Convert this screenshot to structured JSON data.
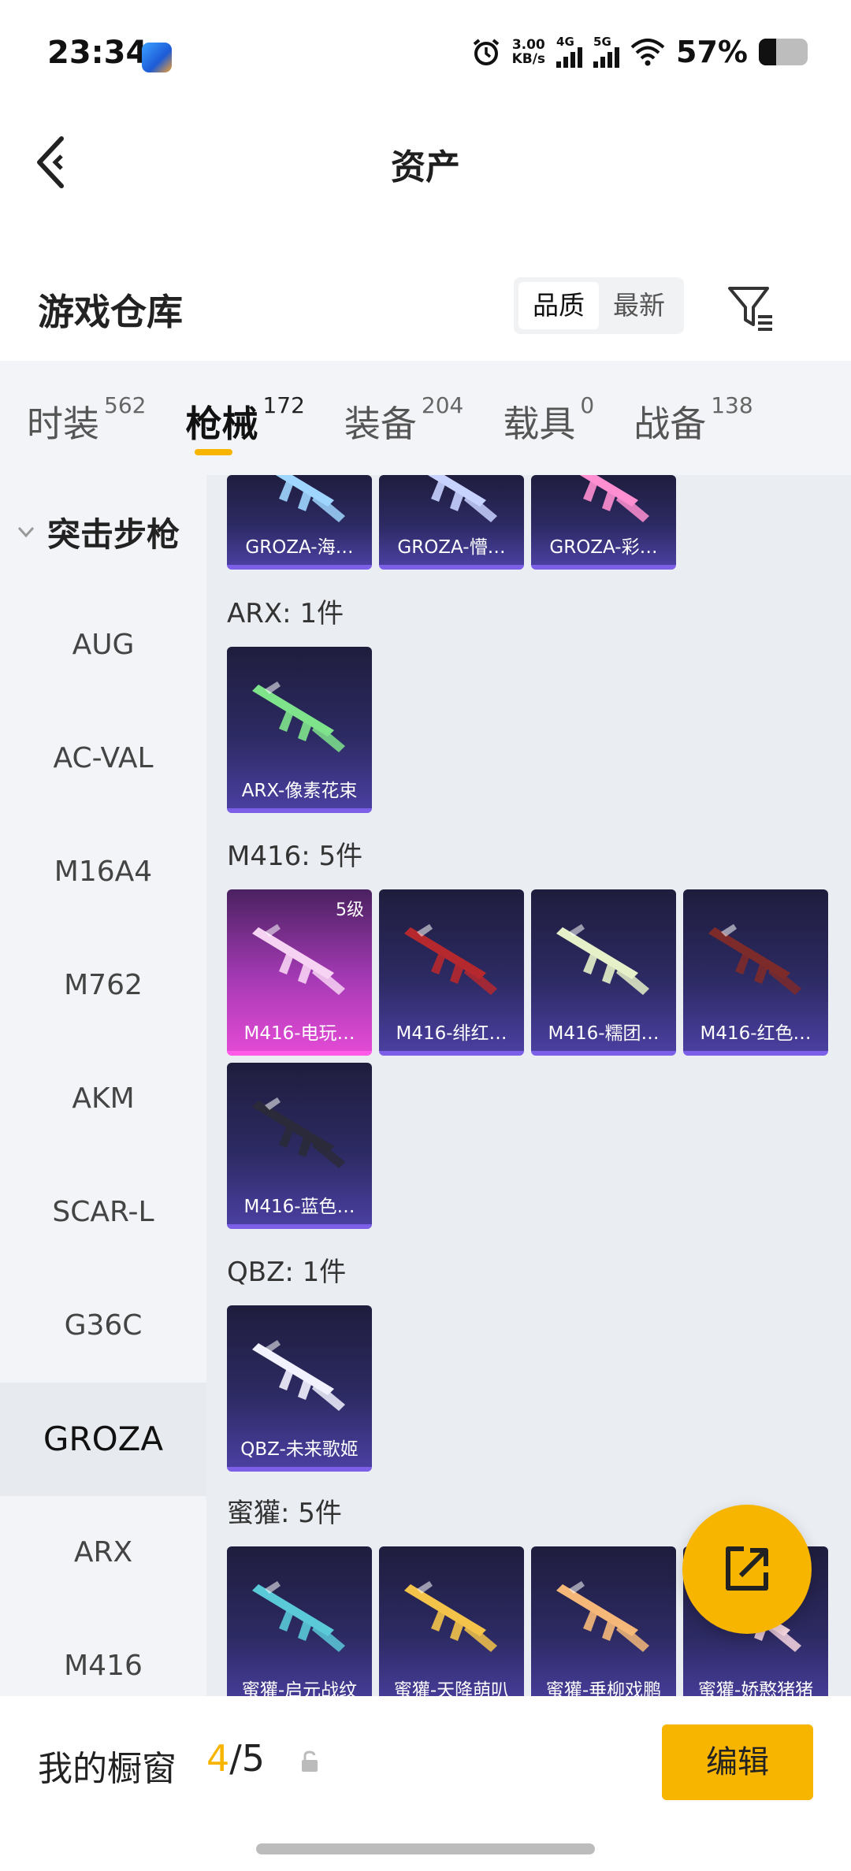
{
  "status_bar": {
    "time": "23:34",
    "net_speed_value": "3.00",
    "net_speed_unit": "KB/s",
    "signal_1": "4G",
    "signal_2": "5G",
    "battery": "57%",
    "icons": [
      "app-icon",
      "alarm-icon",
      "signal-icon",
      "wifi-icon",
      "battery-icon"
    ]
  },
  "nav": {
    "title": "资产",
    "back_icon": "back-chevron-icon"
  },
  "warehouse": {
    "title": "游戏仓库",
    "sort_options": [
      "品质",
      "最新"
    ],
    "sort_selected": "品质",
    "filter_icon": "filter-icon"
  },
  "tabs": [
    {
      "label": "时装",
      "count": "562"
    },
    {
      "label": "枪械",
      "count": "172",
      "active": true
    },
    {
      "label": "装备",
      "count": "204"
    },
    {
      "label": "载具",
      "count": "0"
    },
    {
      "label": "战备",
      "count": "138"
    }
  ],
  "sidebar": {
    "group": "突击步枪",
    "items": [
      "AUG",
      "AC-VAL",
      "M16A4",
      "M762",
      "AKM",
      "SCAR-L",
      "G36C",
      "GROZA",
      "ARX",
      "M416"
    ],
    "selected": "GROZA"
  },
  "sections": [
    {
      "label": "",
      "items": [
        {
          "name": "GROZA-海…",
          "color": "#9fd6ff"
        },
        {
          "name": "GROZA-懵…",
          "color": "#c8d2ff"
        },
        {
          "name": "GROZA-彩…",
          "color": "#ff8fd1"
        }
      ]
    },
    {
      "label": "ARX: 1件",
      "items": [
        {
          "name": "ARX-像素花束",
          "color": "#7fe38c"
        }
      ]
    },
    {
      "label": "M416: 5件",
      "items": [
        {
          "name": "M416-电玩…",
          "color": "#f7d3f3",
          "level": "5级",
          "highlight": true
        },
        {
          "name": "M416-绯红…",
          "color": "#b5282e"
        },
        {
          "name": "M416-糯团…",
          "color": "#e6f1c9"
        },
        {
          "name": "M416-红色…",
          "color": "#7d2a2a"
        },
        {
          "name": "M416-蓝色…",
          "color": "#2a2a3a"
        }
      ]
    },
    {
      "label": "QBZ: 1件",
      "items": [
        {
          "name": "QBZ-未来歌姬",
          "color": "#f2f2ff"
        }
      ]
    },
    {
      "label": "蜜獾: 5件",
      "items": [
        {
          "name": "蜜獾-启元战纹",
          "color": "#5ac9d8"
        },
        {
          "name": "蜜獾-天降萌叭",
          "color": "#f3c34a"
        },
        {
          "name": "蜜獾-垂柳戏鹏",
          "color": "#f5b879"
        },
        {
          "name": "蜜獾-娇憨猪猪",
          "color": "#f8d7e0"
        }
      ]
    }
  ],
  "fab": {
    "icon": "export-icon"
  },
  "bottom": {
    "showcase_label": "我的橱窗",
    "showcase_current": "4",
    "showcase_sep": "/",
    "showcase_total": "5",
    "lock_icon": "lock-icon",
    "edit_label": "编辑"
  },
  "colors": {
    "accent": "#f7b500",
    "card_bg": "#2c2a62",
    "card_border": "#7b5fe6",
    "highlight": "#e24ad4"
  }
}
